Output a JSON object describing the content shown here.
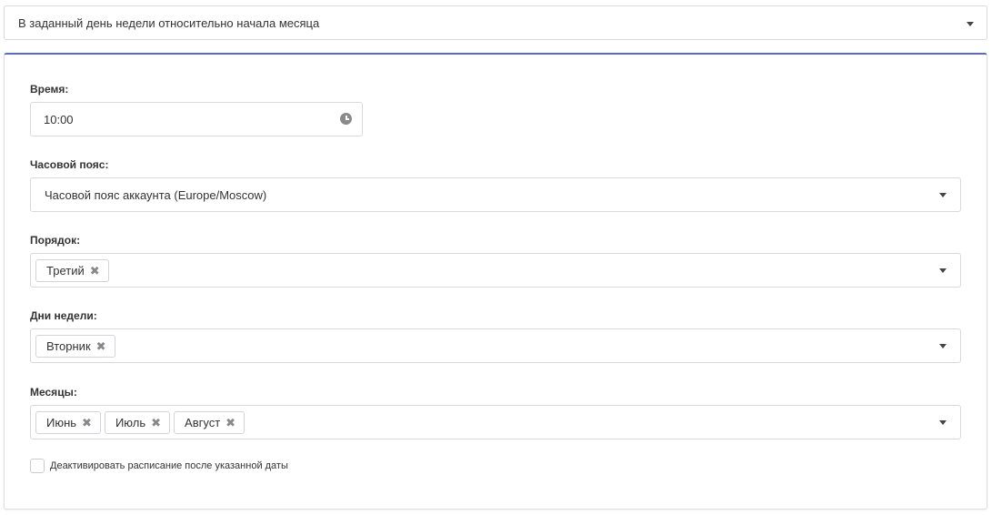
{
  "schedule_type": {
    "selected": "В заданный день недели относительно начала месяца"
  },
  "time": {
    "label": "Время:",
    "value": "10:00",
    "icon": "clock-icon"
  },
  "timezone": {
    "label": "Часовой пояс:",
    "selected": "Часовой пояс аккаунта (Europe/Moscow)"
  },
  "order": {
    "label": "Порядок:",
    "tags": [
      "Третий"
    ]
  },
  "weekdays": {
    "label": "Дни недели:",
    "tags": [
      "Вторник"
    ]
  },
  "months": {
    "label": "Месяцы:",
    "tags": [
      "Июнь",
      "Июль",
      "Август"
    ]
  },
  "deactivate": {
    "label": "Деактивировать расписание после указанной даты",
    "checked": false
  },
  "tag_remove_glyph": "✖",
  "colors": {
    "accent": "#5c6bc0",
    "border": "#d7d9dc",
    "text": "#333333"
  }
}
